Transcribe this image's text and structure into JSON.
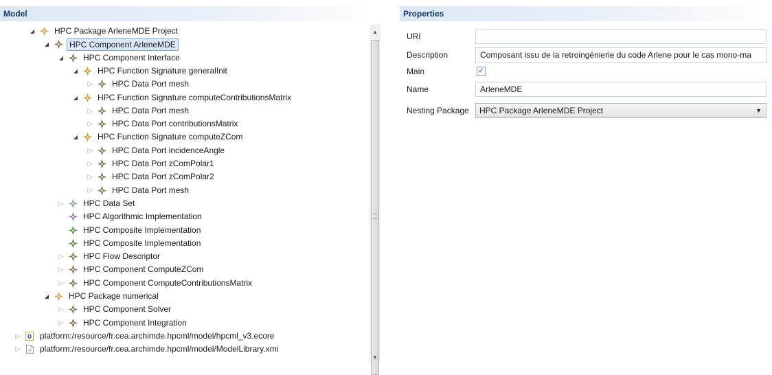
{
  "model_panel": {
    "title": "Model"
  },
  "properties_panel": {
    "title": "Properties"
  },
  "tree": [
    {
      "label": "HPC Package ArleneMDE Project",
      "depth": 1,
      "arrow": "expanded",
      "icon": "package"
    },
    {
      "label": "HPC Component ArleneMDE",
      "depth": 2,
      "arrow": "expanded",
      "icon": "component",
      "selected": true
    },
    {
      "label": "HPC Component Interface",
      "depth": 3,
      "arrow": "expanded",
      "icon": "component"
    },
    {
      "label": "HPC Function Signature generalInit",
      "depth": 4,
      "arrow": "expanded",
      "icon": "function"
    },
    {
      "label": "HPC Data Port mesh",
      "depth": 5,
      "arrow": "collapsed",
      "icon": "component"
    },
    {
      "label": "HPC Function Signature computeContributionsMatrix",
      "depth": 4,
      "arrow": "expanded",
      "icon": "function"
    },
    {
      "label": "HPC Data Port mesh",
      "depth": 5,
      "arrow": "collapsed",
      "icon": "component"
    },
    {
      "label": "HPC Data Port contributionsMatrix",
      "depth": 5,
      "arrow": "collapsed",
      "icon": "component"
    },
    {
      "label": "HPC Function Signature computeZCom",
      "depth": 4,
      "arrow": "expanded",
      "icon": "function"
    },
    {
      "label": "HPC Data Port incidenceAngle",
      "depth": 5,
      "arrow": "collapsed",
      "icon": "component"
    },
    {
      "label": "HPC Data Port zComPolar1",
      "depth": 5,
      "arrow": "collapsed",
      "icon": "component"
    },
    {
      "label": "HPC Data Port zComPolar2",
      "depth": 5,
      "arrow": "collapsed",
      "icon": "component"
    },
    {
      "label": "HPC Data Port mesh",
      "depth": 5,
      "arrow": "collapsed",
      "icon": "component"
    },
    {
      "label": "HPC Data Set",
      "depth": 3,
      "arrow": "collapsed",
      "icon": "dataset"
    },
    {
      "label": "HPC Algorithmic Implementation",
      "depth": 3,
      "arrow": "none",
      "icon": "algorithm"
    },
    {
      "label": "HPC Composite Implementation",
      "depth": 3,
      "arrow": "none",
      "icon": "composite-green"
    },
    {
      "label": "HPC Composite Implementation",
      "depth": 3,
      "arrow": "none",
      "icon": "composite-green"
    },
    {
      "label": "HPC Flow Descriptor",
      "depth": 3,
      "arrow": "collapsed",
      "icon": "component"
    },
    {
      "label": "HPC Component ComputeZCom",
      "depth": 3,
      "arrow": "collapsed",
      "icon": "component"
    },
    {
      "label": "HPC Component ComputeContributionsMatrix",
      "depth": 3,
      "arrow": "collapsed",
      "icon": "component"
    },
    {
      "label": "HPC Package numerical",
      "depth": 2,
      "arrow": "expanded",
      "icon": "package"
    },
    {
      "label": "HPC Component Solver",
      "depth": 3,
      "arrow": "collapsed",
      "icon": "component"
    },
    {
      "label": "HPC Component Integration",
      "depth": 3,
      "arrow": "collapsed",
      "icon": "component"
    },
    {
      "label": "platform:/resource/fr.cea.archimde.hpcml/model/hpcml_v3.ecore",
      "depth": 0,
      "arrow": "collapsed",
      "icon": "ecore-file"
    },
    {
      "label": "platform:/resource/fr.cea.archimde.hpcml/model/ModelLibrary.xmi",
      "depth": 0,
      "arrow": "collapsed",
      "icon": "xmi-file"
    }
  ],
  "properties": {
    "uri_label": "URI",
    "uri_value": "",
    "description_label": "Description",
    "description_value": "Composant issu de la retroingénierie du code Arlene pour le cas mono-ma",
    "main_label": "Main",
    "main_checked": true,
    "main_check_glyph": "✓",
    "name_label": "Name",
    "name_value": "ArleneMDE",
    "nesting_label": "Nesting Package",
    "nesting_value": "HPC Package ArleneMDE Project"
  },
  "glyphs": {
    "expanded": "◢",
    "collapsed": "▷",
    "scroll_up": "▲",
    "scroll_down": "▼",
    "select_arrow": "▼"
  },
  "icon_colors": {
    "package": "#d9a35b",
    "component": "#8a7a5a",
    "function": "#c9a23a",
    "dataset": "#8fa4b8",
    "algorithm": "#9a7fb5",
    "composite-green": "#5f8f4a",
    "ecore-file": "#c7a84a",
    "xmi-file": "#9aa3ad"
  }
}
